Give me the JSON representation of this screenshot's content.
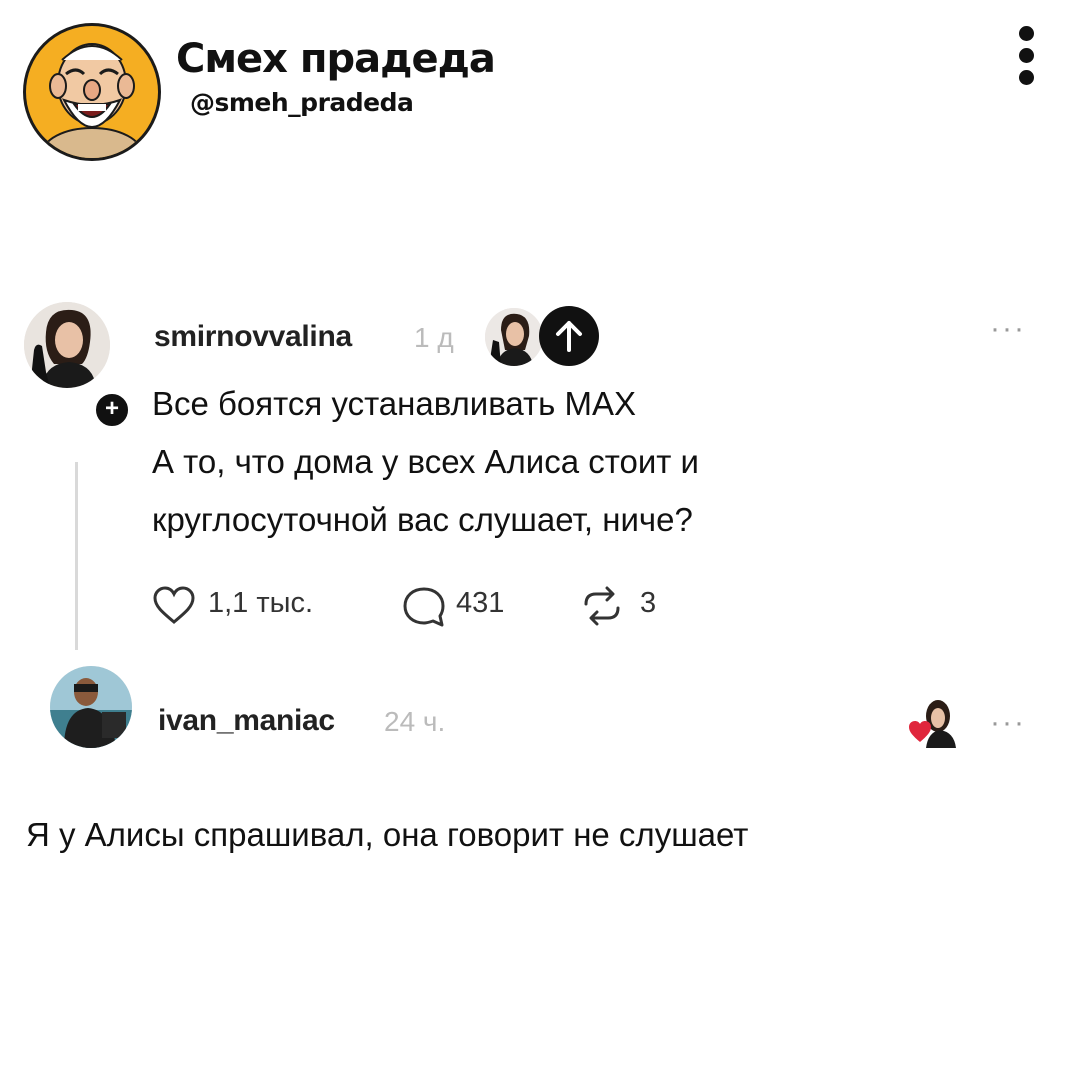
{
  "brand": {
    "title": "Смех прадеда",
    "handle": "@smeh_pradeda",
    "avatar_icon": "grandfather-laughing-avatar",
    "menu_icon": "vertical-dots-icon"
  },
  "post": {
    "username": "smirnovvalina",
    "time": "1 д",
    "lines": [
      "Все боятся устанавливать МАХ",
      "А то, что дома у всех Алиса стоит и",
      "круглосуточной вас слушает, ниче?"
    ],
    "likes": "1,1 тыс.",
    "comments": "431",
    "reposts": "3",
    "follow_icon": "plus-icon",
    "more_label": "···"
  },
  "reply": {
    "username": "ivan_maniac",
    "time": "24 ч.",
    "text": "Я у Алисы спрашивал, она говорит не слушает",
    "more_label": "···"
  },
  "colors": {
    "brand_avatar_bg": "#f5ae22",
    "heart_red": "#e0263c",
    "muted": "#bbbbbb"
  }
}
